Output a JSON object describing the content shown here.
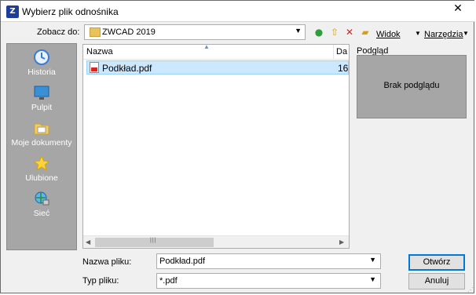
{
  "window": {
    "title": "Wybierz plik odnośnika",
    "close_glyph": "✕",
    "app_icon": "zwcad-app-icon"
  },
  "lookin": {
    "label": "Zobacz do:",
    "value": "ZWCAD 2019"
  },
  "toolbar": {
    "views_label": "Widok",
    "tools_label": "Narzędzia"
  },
  "places": [
    {
      "label": "Historia",
      "icon": "history-icon"
    },
    {
      "label": "Pulpit",
      "icon": "desktop-icon"
    },
    {
      "label": "Moje dokumenty",
      "icon": "documents-icon"
    },
    {
      "label": "Ulubione",
      "icon": "favorites-icon"
    },
    {
      "label": "Sieć",
      "icon": "network-icon"
    }
  ],
  "filelist": {
    "columns": {
      "name": "Nazwa",
      "date": "Da"
    },
    "files": [
      {
        "name": "Podkład.pdf",
        "date": "16."
      }
    ]
  },
  "preview": {
    "label": "Podgląd",
    "empty_text": "Brak podglądu"
  },
  "filename": {
    "label": "Nazwa pliku:",
    "value": "Podkład.pdf"
  },
  "filetype": {
    "label": "Typ pliku:",
    "value": "*.pdf"
  },
  "buttons": {
    "open": "Otwórz",
    "cancel": "Anuluj"
  },
  "colors": {
    "selection": "#cce8ff",
    "places_bg": "#a6a6a6",
    "accent": "#0078d7"
  }
}
